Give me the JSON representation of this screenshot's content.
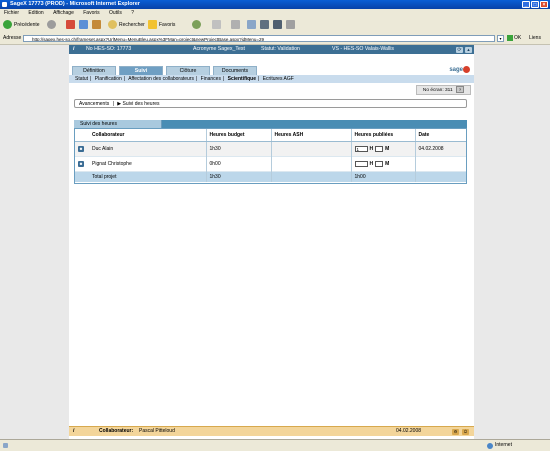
{
  "window": {
    "title": "SageX 17773 (PROD) - Microsoft Internet Explorer"
  },
  "menu": [
    "Fichier",
    "Edition",
    "Affichage",
    "Favoris",
    "Outils",
    "?"
  ],
  "toolbar": {
    "back_label": "Précédente",
    "search_label": "Rechercher",
    "favorites_label": "Favoris"
  },
  "address": {
    "label": "Adresse",
    "url": "http://sagex.hes-so.ch/frameset.aspx?UrlMenu=MenuBleu.aspx%3FMan=project&newProjectBase.aspx?idMenu=29",
    "go_label": "OK",
    "links_label": "Liens"
  },
  "sagex_bar": {
    "info_icon": "i",
    "no_label": "No HES-SO: 17773",
    "acronym": "Acronyme Sagex_Test",
    "status": "Statut: Validation",
    "school": "VS - HES-SO Valais-Wallis"
  },
  "tabs": [
    {
      "label": "Définition",
      "active": false
    },
    {
      "label": "Suivi",
      "active": true
    },
    {
      "label": "Clôture",
      "active": false
    },
    {
      "label": "Documents",
      "active": false
    }
  ],
  "logo": "sage",
  "subnav": [
    "Statut",
    "Planification",
    "Affectation des collaborateurs",
    "Finances",
    "Scientifique",
    "Ecritures AGF"
  ],
  "subnav_active": "Scientifique",
  "screen_no": "No écran: 311",
  "help_icon": "?",
  "breadcrumb": {
    "first": "Avancements",
    "second": "Suivi des heures"
  },
  "panel_title": "Suivi des heures",
  "table": {
    "headers": [
      "Collaborateur",
      "Heures budget",
      "Heures ASH",
      "Heures publiées",
      "Date"
    ],
    "rows": [
      {
        "name": "Duc Alain",
        "budget": "1h30",
        "ash": "",
        "h": "1",
        "m": "",
        "date": "04.02.2008"
      },
      {
        "name": "Pignat Christophe",
        "budget": "0h00",
        "ash": "",
        "h": "",
        "m": "",
        "date": ""
      }
    ],
    "h_label": "H",
    "m_label": "M",
    "total_label": "Total projet",
    "total_budget": "1h30",
    "total_published": "1h00"
  },
  "footer": {
    "info_icon": "i",
    "collab_label": "Collaborateur:",
    "collab_name": "Pascal Pitteloud",
    "date": "04.02.2008"
  },
  "status": {
    "zone": "Internet"
  }
}
